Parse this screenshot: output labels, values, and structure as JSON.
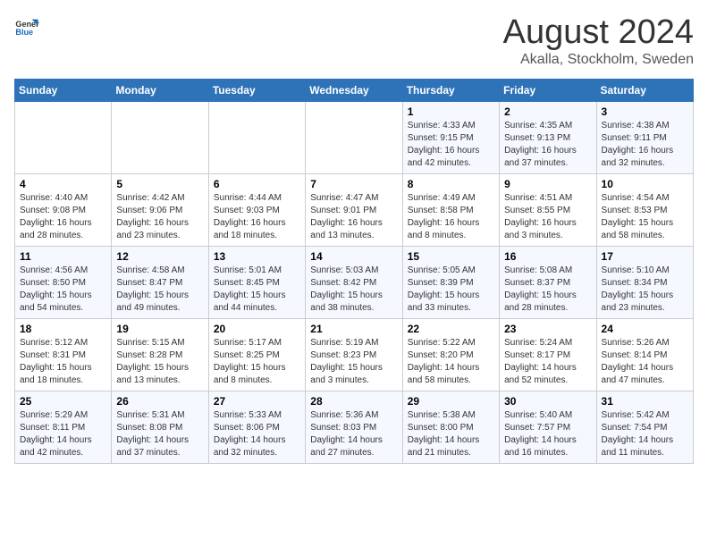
{
  "header": {
    "logo_general": "General",
    "logo_blue": "Blue",
    "title": "August 2024",
    "subtitle": "Akalla, Stockholm, Sweden"
  },
  "weekdays": [
    "Sunday",
    "Monday",
    "Tuesday",
    "Wednesday",
    "Thursday",
    "Friday",
    "Saturday"
  ],
  "weeks": [
    [
      {
        "day": "",
        "detail": ""
      },
      {
        "day": "",
        "detail": ""
      },
      {
        "day": "",
        "detail": ""
      },
      {
        "day": "",
        "detail": ""
      },
      {
        "day": "1",
        "detail": "Sunrise: 4:33 AM\nSunset: 9:15 PM\nDaylight: 16 hours and 42 minutes."
      },
      {
        "day": "2",
        "detail": "Sunrise: 4:35 AM\nSunset: 9:13 PM\nDaylight: 16 hours and 37 minutes."
      },
      {
        "day": "3",
        "detail": "Sunrise: 4:38 AM\nSunset: 9:11 PM\nDaylight: 16 hours and 32 minutes."
      }
    ],
    [
      {
        "day": "4",
        "detail": "Sunrise: 4:40 AM\nSunset: 9:08 PM\nDaylight: 16 hours and 28 minutes."
      },
      {
        "day": "5",
        "detail": "Sunrise: 4:42 AM\nSunset: 9:06 PM\nDaylight: 16 hours and 23 minutes."
      },
      {
        "day": "6",
        "detail": "Sunrise: 4:44 AM\nSunset: 9:03 PM\nDaylight: 16 hours and 18 minutes."
      },
      {
        "day": "7",
        "detail": "Sunrise: 4:47 AM\nSunset: 9:01 PM\nDaylight: 16 hours and 13 minutes."
      },
      {
        "day": "8",
        "detail": "Sunrise: 4:49 AM\nSunset: 8:58 PM\nDaylight: 16 hours and 8 minutes."
      },
      {
        "day": "9",
        "detail": "Sunrise: 4:51 AM\nSunset: 8:55 PM\nDaylight: 16 hours and 3 minutes."
      },
      {
        "day": "10",
        "detail": "Sunrise: 4:54 AM\nSunset: 8:53 PM\nDaylight: 15 hours and 58 minutes."
      }
    ],
    [
      {
        "day": "11",
        "detail": "Sunrise: 4:56 AM\nSunset: 8:50 PM\nDaylight: 15 hours and 54 minutes."
      },
      {
        "day": "12",
        "detail": "Sunrise: 4:58 AM\nSunset: 8:47 PM\nDaylight: 15 hours and 49 minutes."
      },
      {
        "day": "13",
        "detail": "Sunrise: 5:01 AM\nSunset: 8:45 PM\nDaylight: 15 hours and 44 minutes."
      },
      {
        "day": "14",
        "detail": "Sunrise: 5:03 AM\nSunset: 8:42 PM\nDaylight: 15 hours and 38 minutes."
      },
      {
        "day": "15",
        "detail": "Sunrise: 5:05 AM\nSunset: 8:39 PM\nDaylight: 15 hours and 33 minutes."
      },
      {
        "day": "16",
        "detail": "Sunrise: 5:08 AM\nSunset: 8:37 PM\nDaylight: 15 hours and 28 minutes."
      },
      {
        "day": "17",
        "detail": "Sunrise: 5:10 AM\nSunset: 8:34 PM\nDaylight: 15 hours and 23 minutes."
      }
    ],
    [
      {
        "day": "18",
        "detail": "Sunrise: 5:12 AM\nSunset: 8:31 PM\nDaylight: 15 hours and 18 minutes."
      },
      {
        "day": "19",
        "detail": "Sunrise: 5:15 AM\nSunset: 8:28 PM\nDaylight: 15 hours and 13 minutes."
      },
      {
        "day": "20",
        "detail": "Sunrise: 5:17 AM\nSunset: 8:25 PM\nDaylight: 15 hours and 8 minutes."
      },
      {
        "day": "21",
        "detail": "Sunrise: 5:19 AM\nSunset: 8:23 PM\nDaylight: 15 hours and 3 minutes."
      },
      {
        "day": "22",
        "detail": "Sunrise: 5:22 AM\nSunset: 8:20 PM\nDaylight: 14 hours and 58 minutes."
      },
      {
        "day": "23",
        "detail": "Sunrise: 5:24 AM\nSunset: 8:17 PM\nDaylight: 14 hours and 52 minutes."
      },
      {
        "day": "24",
        "detail": "Sunrise: 5:26 AM\nSunset: 8:14 PM\nDaylight: 14 hours and 47 minutes."
      }
    ],
    [
      {
        "day": "25",
        "detail": "Sunrise: 5:29 AM\nSunset: 8:11 PM\nDaylight: 14 hours and 42 minutes."
      },
      {
        "day": "26",
        "detail": "Sunrise: 5:31 AM\nSunset: 8:08 PM\nDaylight: 14 hours and 37 minutes."
      },
      {
        "day": "27",
        "detail": "Sunrise: 5:33 AM\nSunset: 8:06 PM\nDaylight: 14 hours and 32 minutes."
      },
      {
        "day": "28",
        "detail": "Sunrise: 5:36 AM\nSunset: 8:03 PM\nDaylight: 14 hours and 27 minutes."
      },
      {
        "day": "29",
        "detail": "Sunrise: 5:38 AM\nSunset: 8:00 PM\nDaylight: 14 hours and 21 minutes."
      },
      {
        "day": "30",
        "detail": "Sunrise: 5:40 AM\nSunset: 7:57 PM\nDaylight: 14 hours and 16 minutes."
      },
      {
        "day": "31",
        "detail": "Sunrise: 5:42 AM\nSunset: 7:54 PM\nDaylight: 14 hours and 11 minutes."
      }
    ]
  ]
}
